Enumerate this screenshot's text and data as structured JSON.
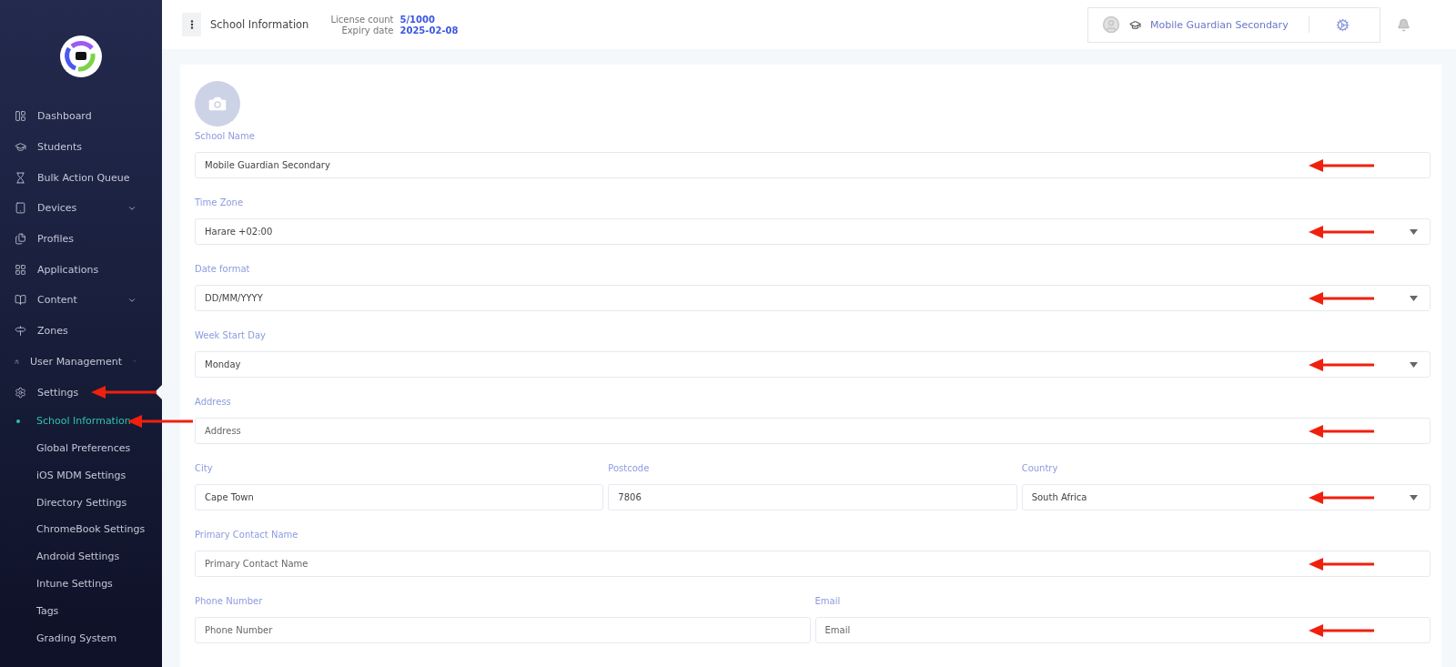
{
  "sidebar": {
    "items": [
      {
        "label": "Dashboard",
        "expandable": false,
        "selected": false,
        "annotated": false
      },
      {
        "label": "Students",
        "expandable": false,
        "selected": false,
        "annotated": false
      },
      {
        "label": "Bulk Action Queue",
        "expandable": false,
        "selected": false,
        "annotated": false
      },
      {
        "label": "Devices",
        "expandable": true,
        "selected": false,
        "annotated": false
      },
      {
        "label": "Profiles",
        "expandable": false,
        "selected": false,
        "annotated": false
      },
      {
        "label": "Applications",
        "expandable": false,
        "selected": false,
        "annotated": false
      },
      {
        "label": "Content",
        "expandable": true,
        "selected": false,
        "annotated": false
      },
      {
        "label": "Zones",
        "expandable": false,
        "selected": false,
        "annotated": false
      },
      {
        "label": "User Management",
        "expandable": true,
        "selected": false,
        "annotated": false
      },
      {
        "label": "Settings",
        "expandable": false,
        "selected": true,
        "annotated": true,
        "children": [
          {
            "label": "School Information",
            "selected": true,
            "annotated": true
          },
          {
            "label": "Global Preferences",
            "selected": false,
            "annotated": false
          },
          {
            "label": "iOS MDM Settings",
            "selected": false,
            "annotated": false
          },
          {
            "label": "Directory Settings",
            "selected": false,
            "annotated": false
          },
          {
            "label": "ChromeBook Settings",
            "selected": false,
            "annotated": false
          },
          {
            "label": "Android Settings",
            "selected": false,
            "annotated": false
          },
          {
            "label": "Intune Settings",
            "selected": false,
            "annotated": false
          },
          {
            "label": "Tags",
            "selected": false,
            "annotated": false
          },
          {
            "label": "Grading System",
            "selected": false,
            "annotated": false
          }
        ]
      }
    ]
  },
  "header": {
    "title": "School Information",
    "license_label": "License count",
    "license_value": "5/1000",
    "expiry_label": "Expiry date",
    "expiry_value": "2025-02-08",
    "school": "Mobile Guardian Secondary"
  },
  "form": {
    "rows": [
      {
        "fields": [
          {
            "label": "School Name",
            "kind": "text",
            "value": "Mobile Guardian Secondary",
            "annotated": true
          }
        ]
      },
      {
        "fields": [
          {
            "label": "Time Zone",
            "kind": "select",
            "value": "Harare +02:00",
            "annotated": true
          }
        ]
      },
      {
        "fields": [
          {
            "label": "Date format",
            "kind": "select",
            "value": "DD/MM/YYYY",
            "annotated": true
          }
        ]
      },
      {
        "fields": [
          {
            "label": "Week Start Day",
            "kind": "select",
            "value": "Monday",
            "annotated": true
          }
        ]
      },
      {
        "fields": [
          {
            "label": "Address",
            "kind": "text",
            "placeholder": "Address",
            "annotated": true
          }
        ]
      },
      {
        "fields": [
          {
            "label": "City",
            "kind": "text",
            "value": "Cape Town",
            "annotated": false
          },
          {
            "label": "Postcode",
            "kind": "text",
            "value": "7806",
            "annotated": false
          },
          {
            "label": "Country",
            "kind": "select",
            "value": "South Africa",
            "annotated": true
          }
        ]
      },
      {
        "fields": [
          {
            "label": "Primary Contact Name",
            "kind": "text",
            "placeholder": "Primary Contact Name",
            "annotated": true
          }
        ]
      },
      {
        "fields": [
          {
            "label": "Phone Number",
            "kind": "text",
            "placeholder": "Phone Number",
            "annotated": false
          },
          {
            "label": "Email",
            "kind": "text",
            "placeholder": "Email",
            "annotated": true
          }
        ]
      }
    ]
  }
}
